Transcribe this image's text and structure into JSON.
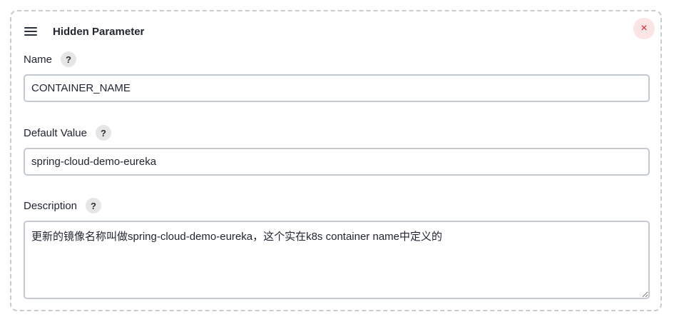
{
  "header": {
    "title": "Hidden Parameter",
    "close_label": "×"
  },
  "fields": {
    "name": {
      "label": "Name",
      "help": "?",
      "value": "CONTAINER_NAME"
    },
    "default_value": {
      "label": "Default Value",
      "help": "?",
      "value": "spring-cloud-demo-eureka"
    },
    "description": {
      "label": "Description",
      "help": "?",
      "value": "更新的镜像名称叫做spring-cloud-demo-eureka，这个实在k8s container name中定义的"
    }
  },
  "colors": {
    "close_bg": "#fbe4e4",
    "close_fg": "#d1242f",
    "border": "#c4c9d0"
  },
  "icons": {
    "drag": "drag-handle-icon",
    "close": "close-icon",
    "help": "help-icon"
  }
}
